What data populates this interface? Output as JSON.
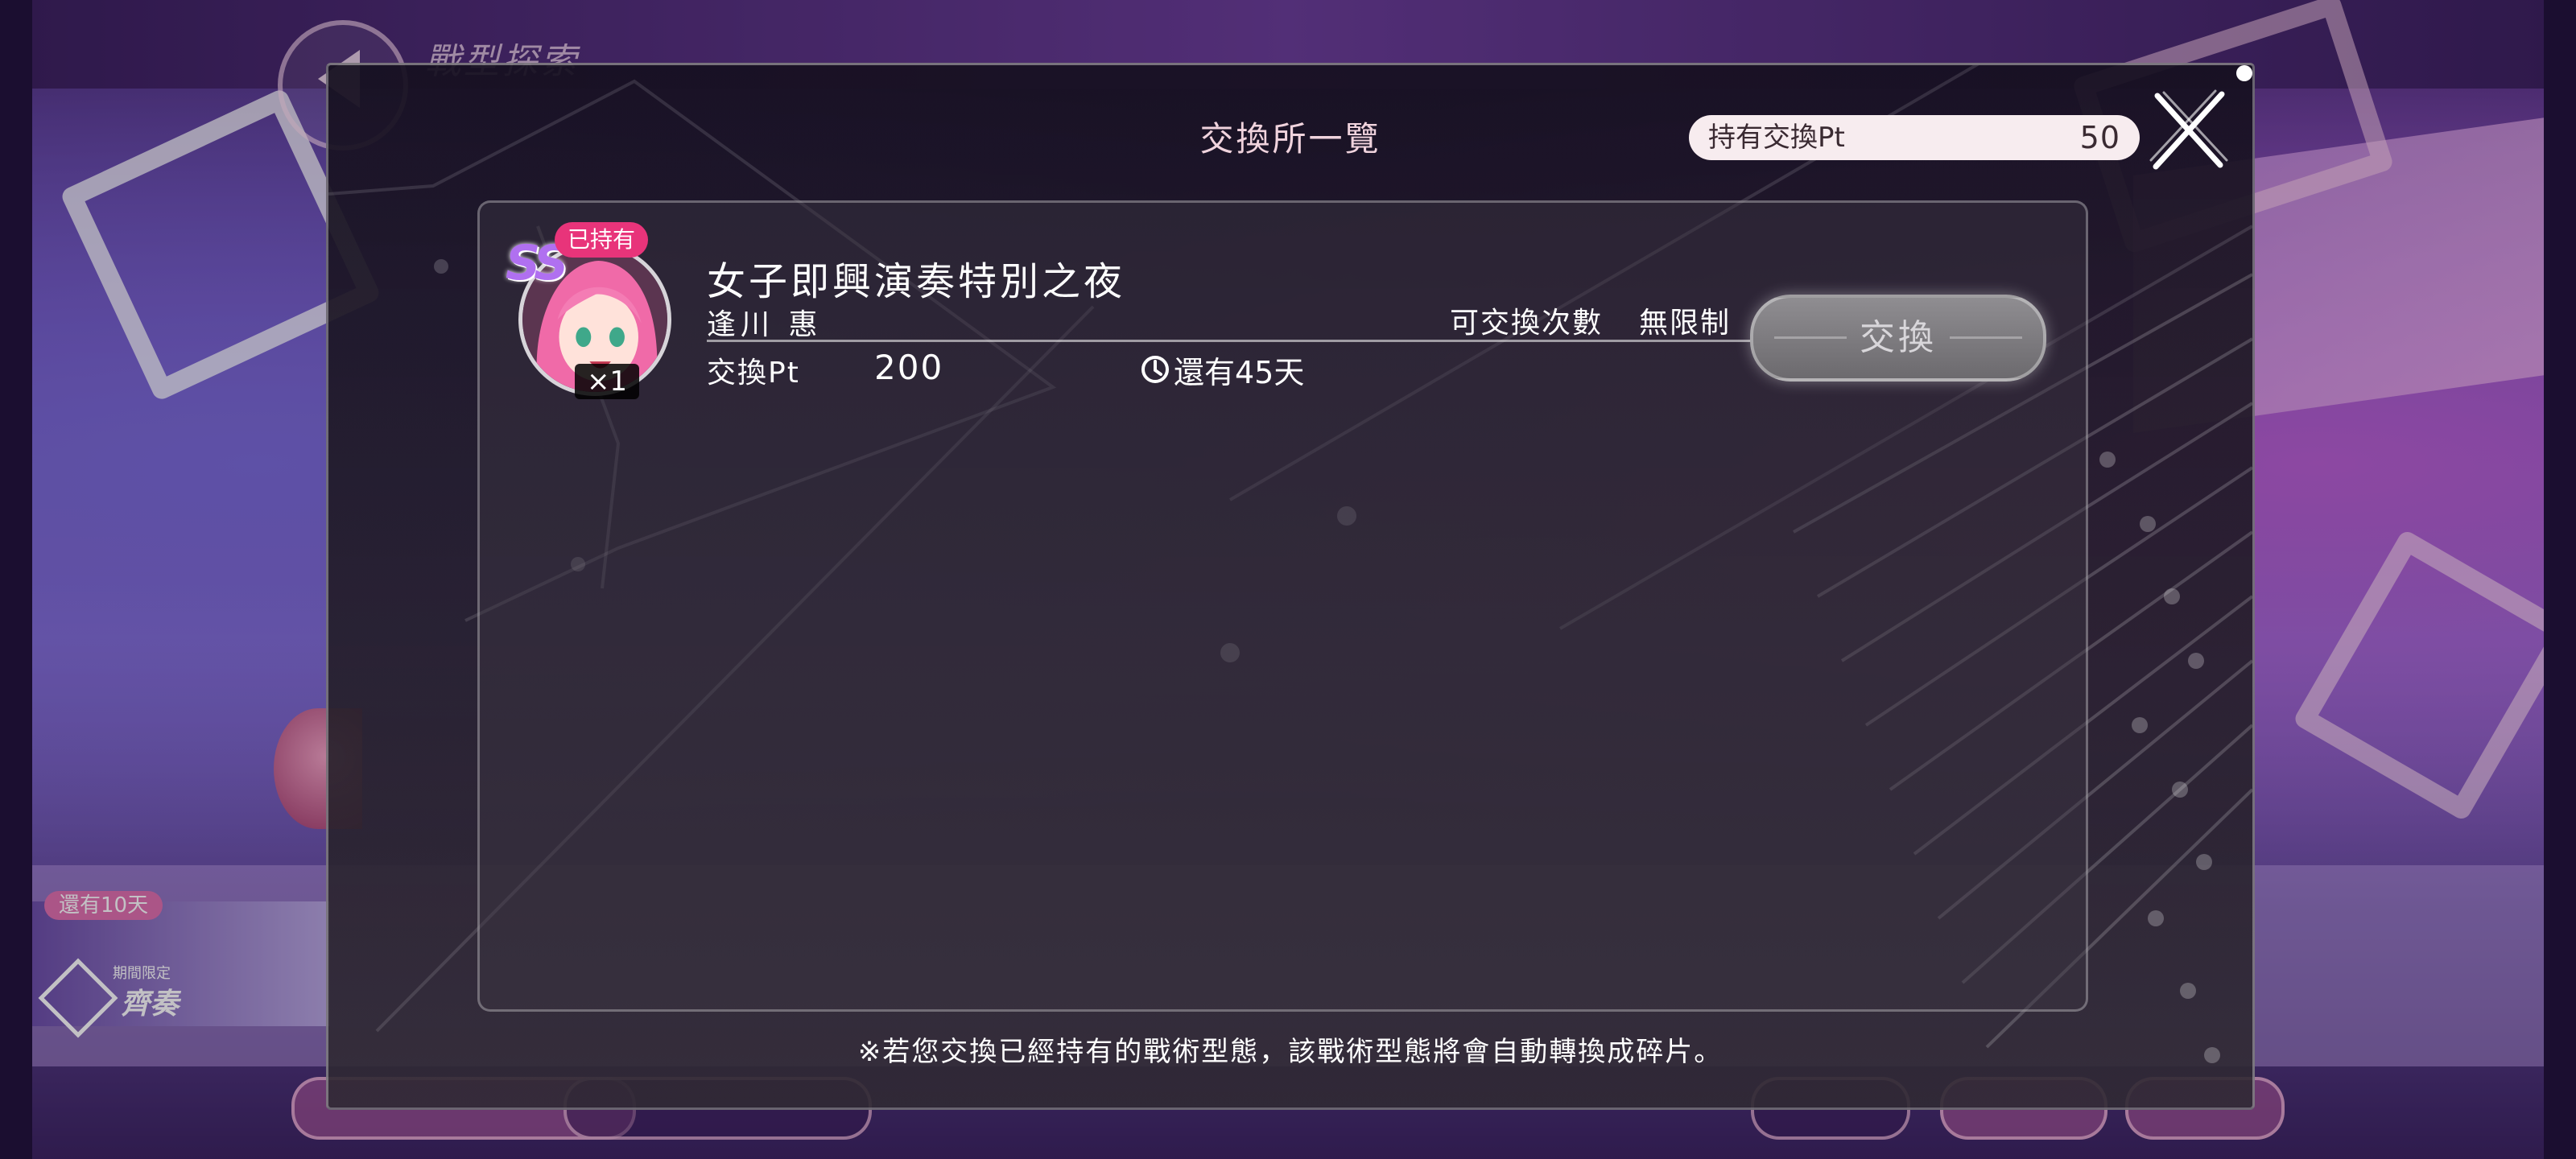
{
  "background": {
    "screen_title": "戰型探索",
    "event_banner": {
      "days_left": "還有10天",
      "limited_tag": "期間限定",
      "name": "齊奏"
    },
    "bottom_tabs": [
      "",
      "",
      "",
      "",
      ""
    ]
  },
  "modal": {
    "title": "交換所一覽",
    "points_label": "持有交換Pt",
    "points_value": "50",
    "close_icon": "close-x-icon",
    "items": [
      {
        "rarity": "SS",
        "owned_badge": "已持有",
        "quantity": "×1",
        "name": "女子即興演奏特別之夜",
        "character": "逢川 惠",
        "limit_label": "可交換次數",
        "limit_value": "無限制",
        "cost_label": "交換Pt",
        "cost_value": "200",
        "time_icon": "clock-icon",
        "time_left": "還有45天",
        "button_label": "交換",
        "button_state": "disabled"
      }
    ],
    "footnote": "※若您交換已經持有的戰術型態，該戰術型態將會自動轉換成碎片。"
  },
  "colors": {
    "owned_badge": "#e8347a",
    "points_pill": "#f7ecef",
    "modal_title": "#f0d3dd",
    "rarity": "#b070f0"
  }
}
